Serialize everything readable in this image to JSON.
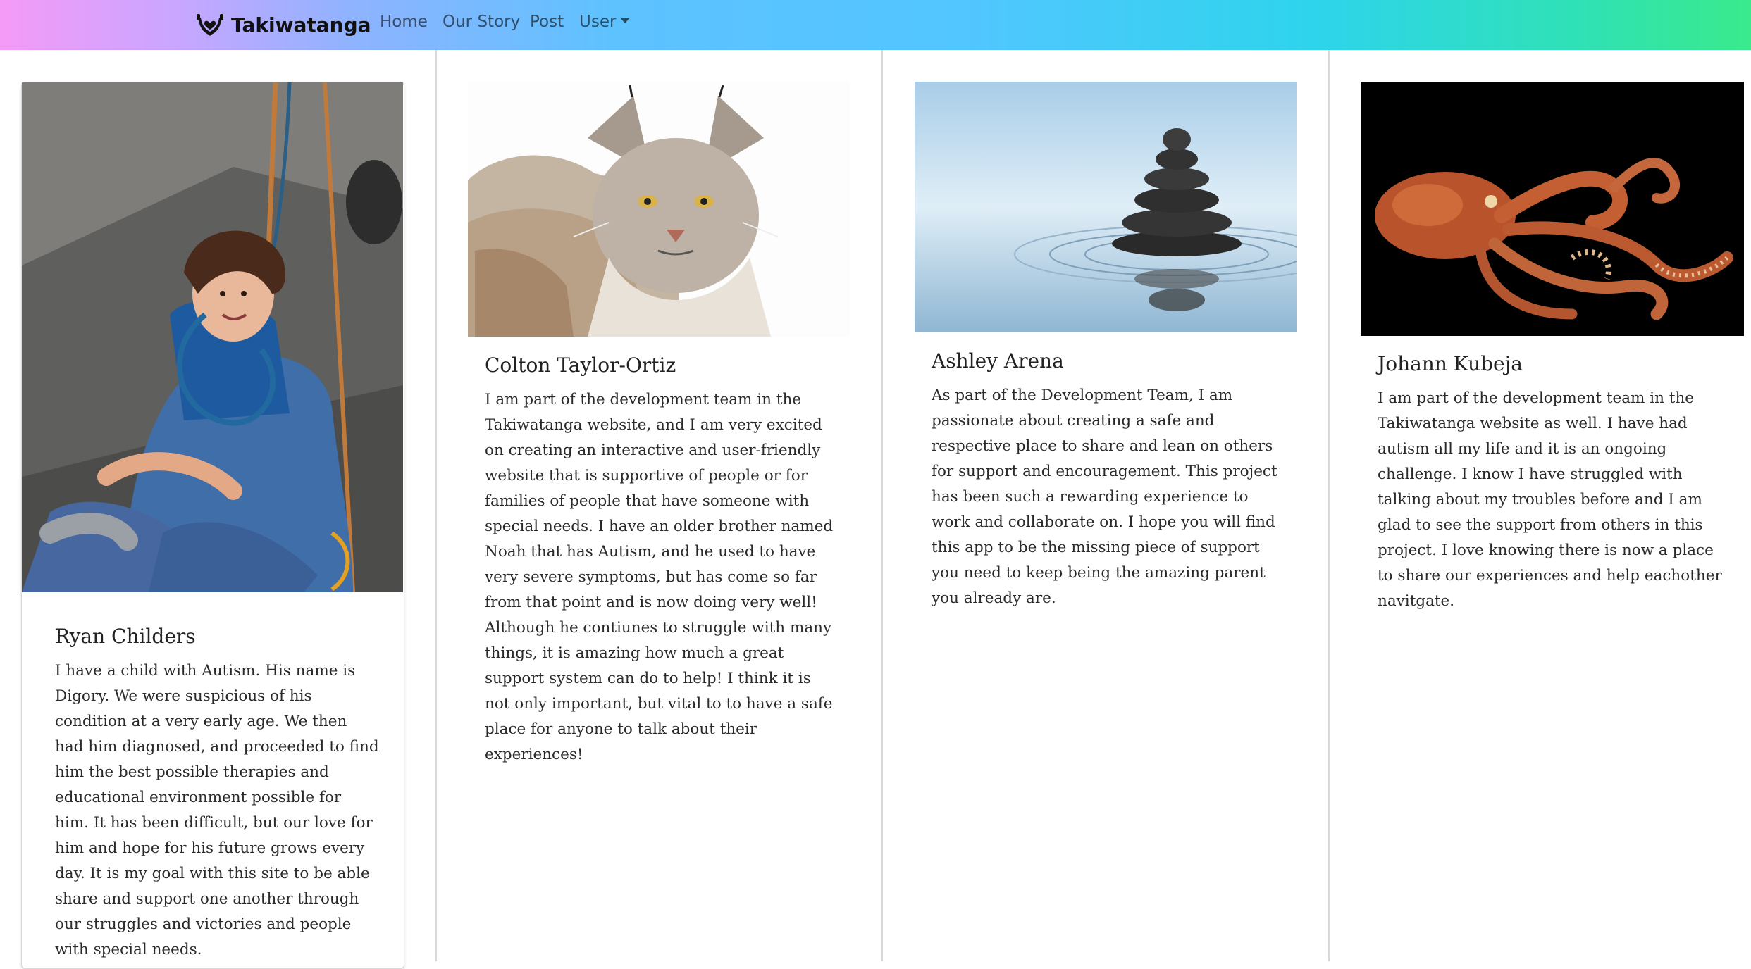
{
  "navbar": {
    "brand": "Takiwatanga",
    "links": [
      "Home",
      "Our Story",
      "Post",
      "User"
    ]
  },
  "team": [
    {
      "name": "Ryan Childers",
      "photo": "boy-climbing-photo",
      "bio": "I have a child with Autism. His name is Digory. We were suspicious of his condition at a very early age. We then had him diagnosed, and proceeded to find him the best possible therapies and educational environment possible for him. It has been difficult, but our love for him and hope for his future grows every day. It is my goal with this site to be able share and support one another through our struggles and victories and people with special needs."
    },
    {
      "name": "Colton Taylor-Ortiz",
      "photo": "lynx-photo",
      "bio": "I am part of the development team in the Takiwatanga website, and I am very excited on creating an interactive and user-friendly website that is supportive of people or for families of people that have someone with special needs. I have an older brother named Noah that has Autism, and he used to have very severe symptoms, but has come so far from that point and is now doing very well! Although he contiunes to struggle with many things, it is amazing how much a great support system can do to help! I think it is not only important, but vital to to have a safe place for anyone to talk about their experiences!"
    },
    {
      "name": "Ashley Arena",
      "photo": "stacked-stones-photo",
      "bio": "As part of the Development Team, I am passionate about creating a safe and respective place to share and lean on others for support and encouragement. This project has been such a rewarding experience to work and collaborate on. I hope you will find this app to be the missing piece of support you need to keep being the amazing parent you already are."
    },
    {
      "name": "Johann Kubeja",
      "photo": "octopus-photo",
      "bio": "I am part of the development team in the Takiwatanga website as well. I have had autism all my life and it is an ongoing challenge. I know I have struggled with talking about my troubles before and I am glad to see the support from others in this project. I love knowing there is now a place to share our experiences and help eachother navitgate."
    }
  ],
  "colors": {
    "gradient_start": "#f49bf7",
    "gradient_mid": "#52c6ff",
    "gradient_end": "#3aea8c"
  }
}
